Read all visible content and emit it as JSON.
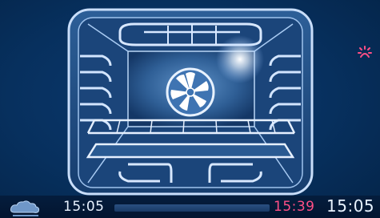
{
  "status_bar": {
    "elapsed_time": "15:05",
    "end_time": "15:39",
    "clock": "15:05",
    "progress_fraction": 0.0
  },
  "icons": {
    "mode_icon": "steam-cloud-icon",
    "oven_icon": "oven-fan-icon",
    "side_icon": "heat-indicator-icon"
  },
  "colors": {
    "end_time": "#ff4f86",
    "time_text": "#e8f2ff",
    "accent": "#5fa0ea"
  }
}
